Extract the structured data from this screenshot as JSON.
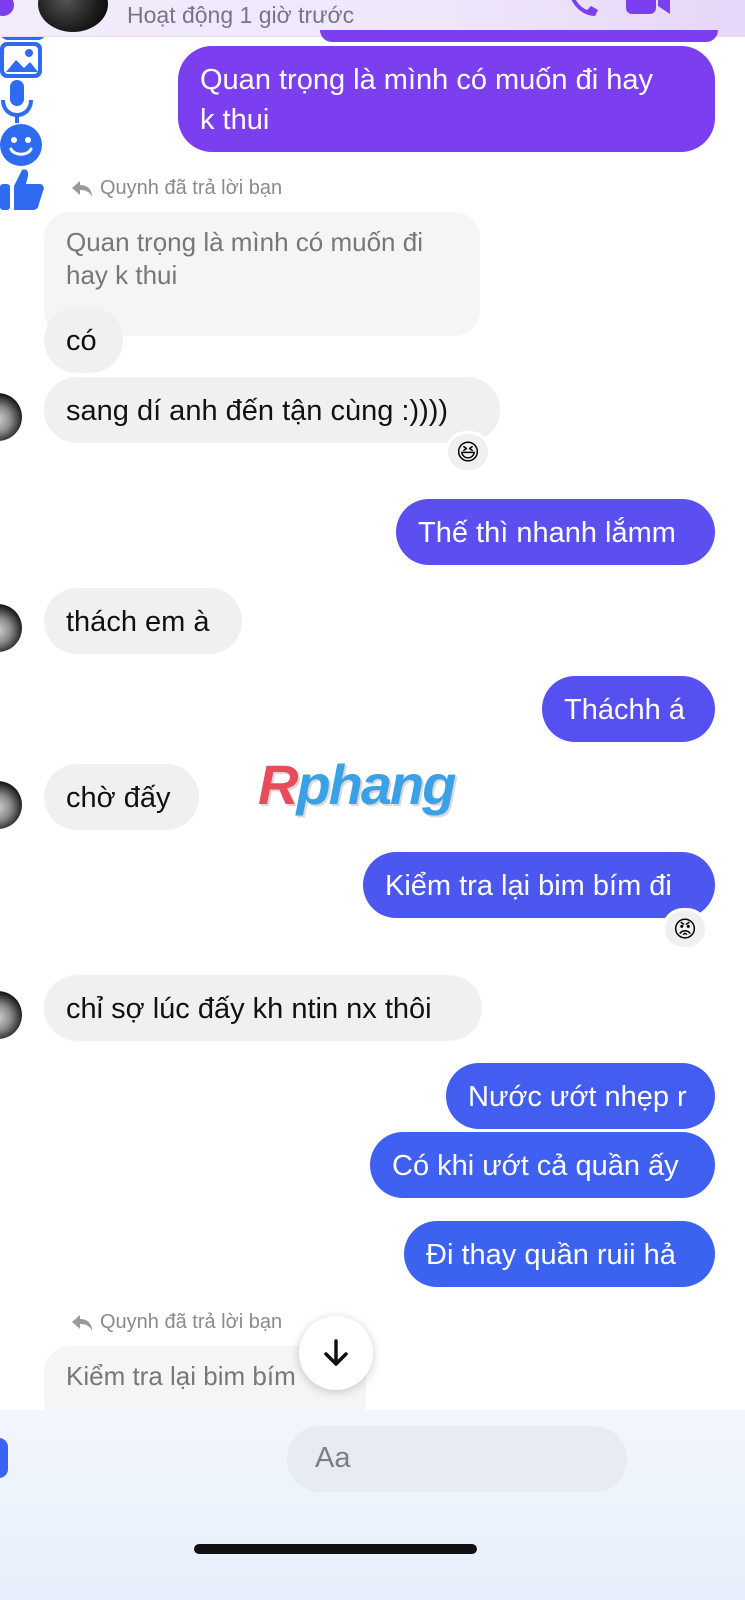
{
  "header": {
    "status": "Hoạt động 1 giờ trước",
    "icons": [
      "phone-icon",
      "video-icon"
    ]
  },
  "messages": {
    "m1": "Quan trọng là mình có muốn đi hay\nk thui",
    "reply1_label": "Quynh đã trả lời bạn",
    "reply1_quote": "Quan trọng là mình có muốn đi\nhay k thui",
    "m2": "có",
    "m3": "sang dí anh đến tận cùng :))))",
    "m3_reaction": "😆",
    "m4": "Thế thì nhanh lắmm",
    "m5": "thách em à",
    "m6": "Tháchh á",
    "m7": "chờ đấy",
    "m8": "Kiểm tra lại bim bím đi",
    "m8_reaction": "😡",
    "m9": "chỉ sợ lúc đấy kh ntin nx thôi",
    "m10": "Nước ướt nhẹp r",
    "m11": "Có khi ướt cả quần ấy",
    "m12": "Đi thay quần ruii hả",
    "reply2_label": "Quynh đã trả lời bạn",
    "reply2_quote": "Kiểm tra lại bim bím"
  },
  "watermark": "Rphang",
  "composer": {
    "placeholder": "Aa",
    "icons": [
      "camera-icon",
      "gallery-icon",
      "microphone-icon",
      "emoji-icon",
      "like-icon"
    ]
  },
  "colors": {
    "out_purple": "#7b3ff0",
    "out_violet": "#5b4ff0",
    "out_blue": "#3f5ef0",
    "in_gray": "#f0f0f0"
  }
}
